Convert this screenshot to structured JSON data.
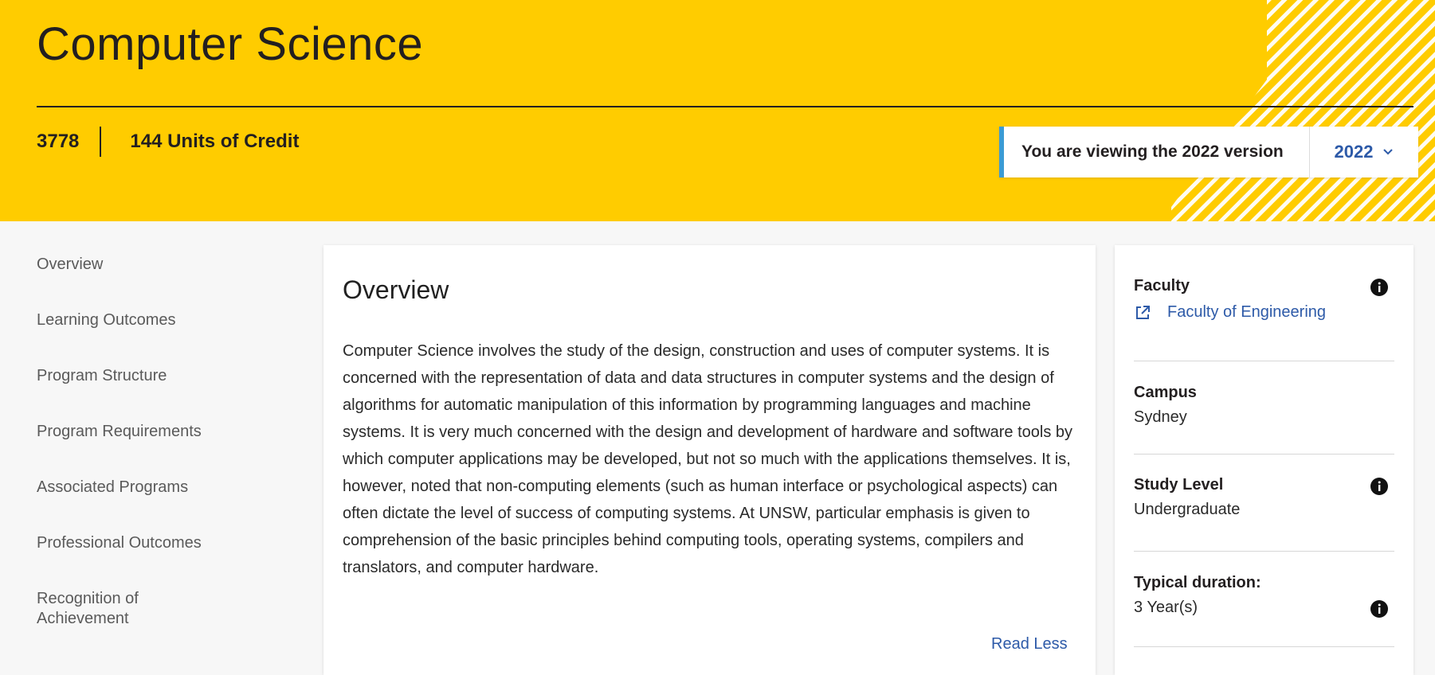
{
  "header": {
    "title": "Computer Science",
    "program_code": "3778",
    "units_of_credit": "144 Units of Credit",
    "version_notice": "You are viewing the 2022 version",
    "selected_year": "2022",
    "colors": {
      "hero_bg": "#ffcc00",
      "accent": "#3b9bd4",
      "link": "#2d5aa8"
    }
  },
  "sidenav": {
    "items": [
      {
        "label": "Overview"
      },
      {
        "label": "Learning Outcomes"
      },
      {
        "label": "Program Structure"
      },
      {
        "label": "Program Requirements"
      },
      {
        "label": "Associated Programs"
      },
      {
        "label": "Professional Outcomes"
      },
      {
        "label": "Recognition of Achievement"
      }
    ]
  },
  "overview": {
    "heading": "Overview",
    "body": "Computer Science involves the study of the design, construction and uses of computer systems. It is concerned with the representation of data and data structures in computer systems and the design of algorithms for automatic manipulation of this information by programming languages and machine systems. It is very much concerned with the design and development of hardware and software tools by which computer applications may be developed, but not so much with the applications themselves. It is, however, noted that non-computing elements (such as human interface or psychological aspects) can often dictate the level of success of computing systems. At UNSW, particular emphasis is given to comprehension of the basic principles behind computing tools, operating systems, compilers and translators, and computer hardware.",
    "read_less": "Read Less"
  },
  "info": {
    "faculty_label": "Faculty",
    "faculty_link": "Faculty of Engineering",
    "campus_label": "Campus",
    "campus_value": "Sydney",
    "study_level_label": "Study Level",
    "study_level_value": "Undergraduate",
    "duration_label": "Typical duration:",
    "duration_value": "3 Year(s)"
  }
}
